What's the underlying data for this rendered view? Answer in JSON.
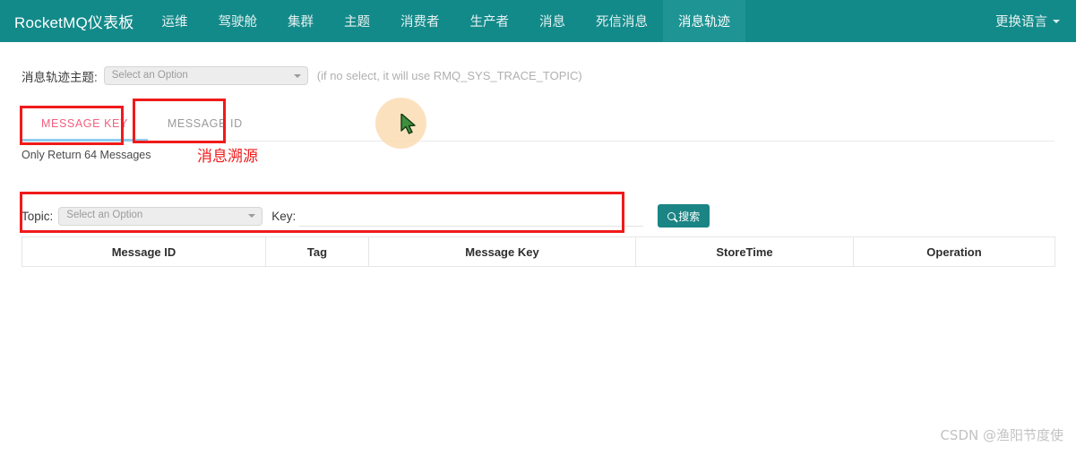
{
  "navbar": {
    "brand": "RocketMQ仪表板",
    "items": [
      {
        "label": "运维",
        "active": false
      },
      {
        "label": "驾驶舱",
        "active": false
      },
      {
        "label": "集群",
        "active": false
      },
      {
        "label": "主题",
        "active": false
      },
      {
        "label": "消费者",
        "active": false
      },
      {
        "label": "生产者",
        "active": false
      },
      {
        "label": "消息",
        "active": false
      },
      {
        "label": "死信消息",
        "active": false
      },
      {
        "label": "消息轨迹",
        "active": true
      }
    ],
    "language_label": "更换语言",
    "bg_color": "#138a8a",
    "active_bg_color": "#1f9494"
  },
  "trace_topic": {
    "label": "消息轨迹主题:",
    "select_placeholder": "Select an Option",
    "select_value": "",
    "hint": "(if no select, it will use RMQ_SYS_TRACE_TOPIC)"
  },
  "tabs": [
    {
      "label": "MESSAGE KEY",
      "active": true
    },
    {
      "label": "MESSAGE ID",
      "active": false
    }
  ],
  "tab_colors": {
    "active_text": "#f0617f",
    "inactive_text": "#9a9a9a",
    "underline": "#8fcdf0"
  },
  "info": {
    "only_return": "Only Return 64 Messages"
  },
  "search": {
    "topic_label": "Topic:",
    "topic_placeholder": "Select an Option",
    "topic_value": "",
    "key_label": "Key:",
    "key_placeholder": "",
    "key_value": "",
    "button_label": "搜索",
    "button_color": "#1b8484"
  },
  "table": {
    "headers": [
      "Message ID",
      "Tag",
      "Message Key",
      "StoreTime",
      "Operation"
    ],
    "rows": []
  },
  "annotations": {
    "color": "#f01a1a",
    "trace_text": "消息溯源"
  },
  "watermark": "CSDN @渔阳节度使"
}
